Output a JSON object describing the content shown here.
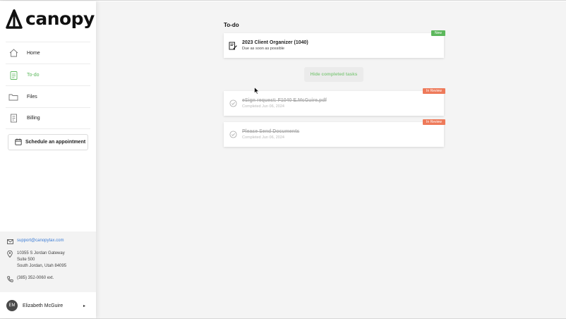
{
  "app": {
    "logo_text": "canopy"
  },
  "sidebar": {
    "items": [
      {
        "label": "Home",
        "icon": "home-icon",
        "active": false
      },
      {
        "label": "To-do",
        "icon": "clipboard-icon",
        "active": true
      },
      {
        "label": "Files",
        "icon": "folder-icon",
        "active": false
      },
      {
        "label": "Billing",
        "icon": "receipt-icon",
        "active": false
      }
    ],
    "appointment_button": "Schedule an appointment"
  },
  "contact": {
    "email": "support@canopytax.com",
    "address_line1": "10355 S Jordan Gateway",
    "address_line2": "Suite 500",
    "address_line3": "South Jordan, Utah 84095",
    "phone": "(385) 352-0060 ext."
  },
  "user": {
    "initials": "EM",
    "name": "Elizabeth McGuire"
  },
  "main": {
    "title": "To-do",
    "open_tasks": [
      {
        "title": "2023 Client Organizer (1040)",
        "subtitle": "Due as soon as possible",
        "badge": "New"
      }
    ],
    "hide_button": "Hide completed tasks",
    "completed_tasks": [
      {
        "title": "eSign request: F1040 E.McGuire.pdf",
        "subtitle": "Completed Jun 06, 2024",
        "badge": "In Review"
      },
      {
        "title": "Please Send Documents",
        "subtitle": "Completed Jun 06, 2024",
        "badge": "In Review"
      }
    ]
  },
  "colors": {
    "accent_green": "#5cb85c",
    "review_orange": "#ee7a5a",
    "link_blue": "#3a7bd5"
  }
}
